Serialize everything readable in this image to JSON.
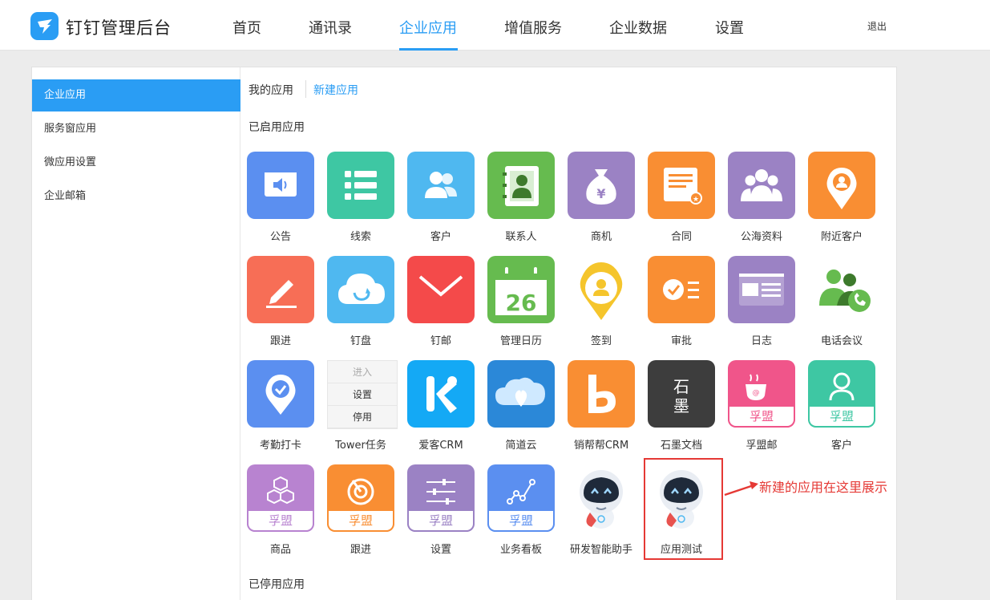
{
  "header": {
    "brand": "钉钉管理后台",
    "nav": [
      "首页",
      "通讯录",
      "企业应用",
      "增值服务",
      "企业数据",
      "设置"
    ],
    "active_nav": "企业应用",
    "logout": "退出"
  },
  "sidebar": {
    "items": [
      "企业应用",
      "服务窗应用",
      "微应用设置",
      "企业邮箱"
    ]
  },
  "tabs": {
    "my_apps": "我的应用",
    "new_app": "新建应用"
  },
  "sections": {
    "enabled": "已启用应用",
    "disabled": "已停用应用"
  },
  "apps": [
    {
      "label": "公告",
      "icon": "announcement-icon",
      "color": "#5b8ff0"
    },
    {
      "label": "线索",
      "icon": "list-icon",
      "color": "#3ec7a3"
    },
    {
      "label": "客户",
      "icon": "customers-icon",
      "color": "#4fb8f0"
    },
    {
      "label": "联系人",
      "icon": "contact-card-icon",
      "color": "#66bb4f"
    },
    {
      "label": "商机",
      "icon": "money-bag-icon",
      "color": "#9b82c4"
    },
    {
      "label": "合同",
      "icon": "contract-icon",
      "color": "#f98e33"
    },
    {
      "label": "公海资料",
      "icon": "group-icon",
      "color": "#9b82c4"
    },
    {
      "label": "附近客户",
      "icon": "location-person-icon",
      "color": "#f98e33"
    },
    {
      "label": "跟进",
      "icon": "pencil-icon",
      "color": "#f76e56"
    },
    {
      "label": "钉盘",
      "icon": "cloud-icon",
      "color": "#4fb8f0"
    },
    {
      "label": "钉邮",
      "icon": "mail-icon",
      "color": "#f44a4a"
    },
    {
      "label": "管理日历",
      "icon": "calendar-icon",
      "color": "#66bb4f",
      "day": "26"
    },
    {
      "label": "签到",
      "icon": "checkin-pin-icon",
      "color": "#f5c52c"
    },
    {
      "label": "审批",
      "icon": "approval-icon",
      "color": "#f98e33"
    },
    {
      "label": "日志",
      "icon": "log-icon",
      "color": "#9b82c4"
    },
    {
      "label": "电话会议",
      "icon": "phone-conference-icon",
      "color": "#66bb4f"
    },
    {
      "label": "考勤打卡",
      "icon": "attendance-icon",
      "color": "#5b8ff0"
    },
    {
      "label": "Tower任务",
      "icon": "tower-icon",
      "color": "#f5f5f5"
    },
    {
      "label": "爱客CRM",
      "icon": "ik-logo-icon",
      "color": "#14a9f5"
    },
    {
      "label": "简道云",
      "icon": "jiandao-cloud-icon",
      "color": "#2b88d8"
    },
    {
      "label": "销帮帮CRM",
      "icon": "b-logo-icon",
      "color": "#f98e33"
    },
    {
      "label": "石墨文档",
      "icon": "shimo-logo-icon",
      "color": "#3d3d3d",
      "text": "石墨"
    },
    {
      "label": "孚盟邮",
      "icon": "coffee-mail-icon",
      "color": "#f0558a",
      "badge": "孚盟"
    },
    {
      "label": "客户",
      "icon": "user-icon",
      "color": "#3ec7a3",
      "badge": "孚盟"
    },
    {
      "label": "商品",
      "icon": "cubes-icon",
      "color": "#b883d0",
      "badge": "孚盟"
    },
    {
      "label": "跟进",
      "icon": "target-icon",
      "color": "#f98e33",
      "badge": "孚盟"
    },
    {
      "label": "设置",
      "icon": "sliders-icon",
      "color": "#9b82c4",
      "badge": "孚盟"
    },
    {
      "label": "业务看板",
      "icon": "chart-line-icon",
      "color": "#5b8ff0",
      "badge": "孚盟"
    },
    {
      "label": "研发智能助手",
      "icon": "robot-icon",
      "color": "#ffffff"
    },
    {
      "label": "应用测试",
      "icon": "robot-icon",
      "color": "#ffffff"
    }
  ],
  "tower_menu": [
    "进入",
    "设置",
    "停用"
  ],
  "annotation": {
    "text": "新建的应用在这里展示",
    "color": "#e53935"
  }
}
